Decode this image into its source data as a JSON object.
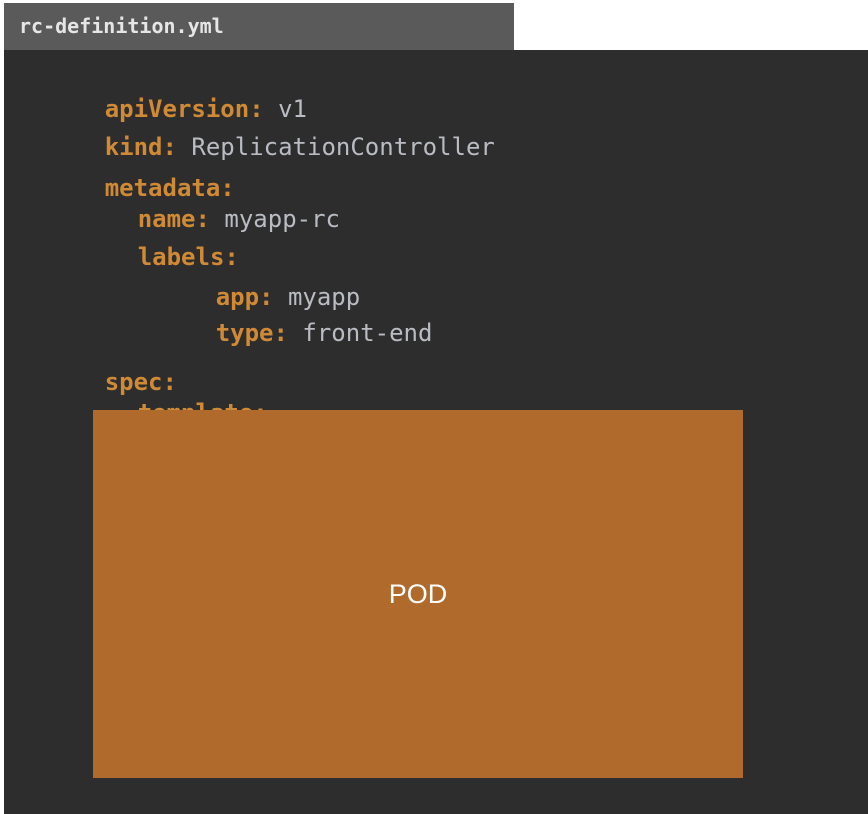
{
  "file_tab": {
    "filename": "rc-definition.yml"
  },
  "yaml": {
    "api_version_key": "apiVersion:",
    "api_version_value": "v1",
    "kind_key": "kind:",
    "kind_value": "ReplicationController",
    "metadata_key": "metadata:",
    "name_key": "name:",
    "name_value": "myapp-rc",
    "labels_key": "labels:",
    "app_key": "app:",
    "app_value": "myapp",
    "type_key": "type:",
    "type_value": "front-end",
    "spec_key": "spec:",
    "template_key": "template:"
  },
  "pod_box": {
    "label": "POD"
  },
  "colors": {
    "editor_background": "#2d2d2d",
    "tab_background": "#5a5a5a",
    "key_color": "#d08a36",
    "value_color": "#b9bcc2",
    "pod_fill": "#b06a2b"
  }
}
